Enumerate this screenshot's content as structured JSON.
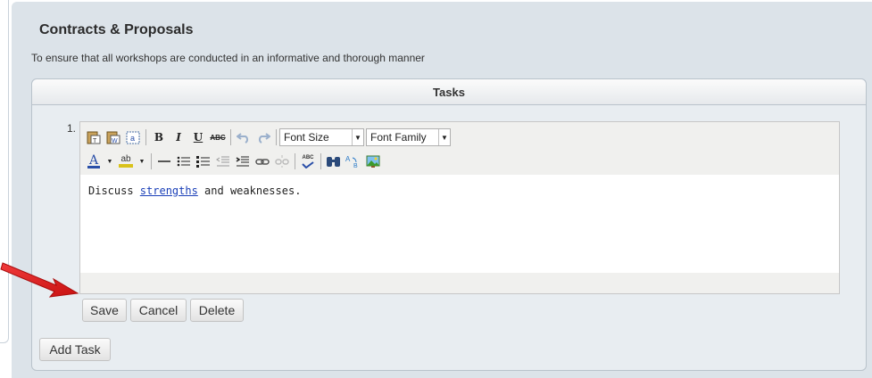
{
  "section": {
    "title": "Contracts & Proposals",
    "description": "To ensure that all workshops are conducted in an informative and thorough manner"
  },
  "tasks": {
    "header": "Tasks",
    "item_number": "1.",
    "editor": {
      "text_before": "Discuss ",
      "link_text": "strengths",
      "text_after": " and weaknesses.",
      "font_size_label": "Font Size",
      "font_family_label": "Font Family",
      "bold_label": "B",
      "italic_label": "I",
      "underline_label": "U",
      "strike_label": "ABC",
      "font_color_label": "A",
      "highlight_label": "ab",
      "spell_label": "ABC"
    },
    "buttons": {
      "save": "Save",
      "cancel": "Cancel",
      "delete": "Delete"
    },
    "add_task": "Add Task"
  },
  "colors": {
    "panel_bg": "#dce3e9",
    "link": "#1a3fb8",
    "arrow": "#e21b1b"
  }
}
